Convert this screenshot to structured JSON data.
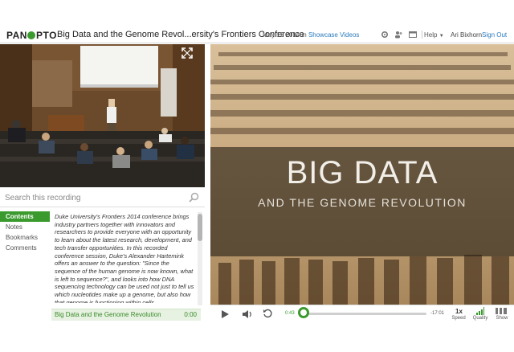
{
  "header": {
    "logo": "PANOPTO",
    "logo_pre": "PAN",
    "logo_post": "PTO",
    "recording_title": "Big Data and the Genome Revol...ersity's Frontiers Conference",
    "date_prefix": "May 12 2014 in",
    "folder_link": "Showcase Videos",
    "help_label": "Help",
    "user_name": "Ari Bixhorn",
    "sign_out_label": "Sign Out",
    "icons": [
      "gear-icon",
      "users-icon",
      "window-icon",
      "layout-icon"
    ]
  },
  "search": {
    "placeholder": "Search this recording"
  },
  "side_tabs": [
    {
      "label": "Contents",
      "active": true
    },
    {
      "label": "Notes",
      "active": false
    },
    {
      "label": "Bookmarks",
      "active": false
    },
    {
      "label": "Comments",
      "active": false
    }
  ],
  "description": "Duke University's Frontiers 2014 conference brings industry partners together with innovators and researchers to provide everyone with an opportunity to learn about the latest research, development, and tech transfer opportunities. In this recorded conference session, Duke's Alexander Hartemink offers an answer to the question: \"Since the sequence of the human genome is now known, what is left to sequence?\", and looks into how DNA sequencing technology can be used not just to tell us which nucleotides make up a genome, but also how that genome is functioning within cells.",
  "contents": {
    "item_title": "Big Data and the Genome Revolution",
    "item_time": "0:00"
  },
  "slide": {
    "title": "BIG DATA",
    "subtitle": "AND THE GENOME REVOLUTION"
  },
  "player": {
    "elapsed": "0:43",
    "remaining": "-17:01",
    "progress_fraction": 0.01,
    "speed_value": "1x",
    "speed_label": "Speed",
    "quality_label": "Quality",
    "show_label": "Show"
  },
  "colors": {
    "accent_green": "#3a9a2e",
    "link_blue": "#2a7bbf"
  }
}
